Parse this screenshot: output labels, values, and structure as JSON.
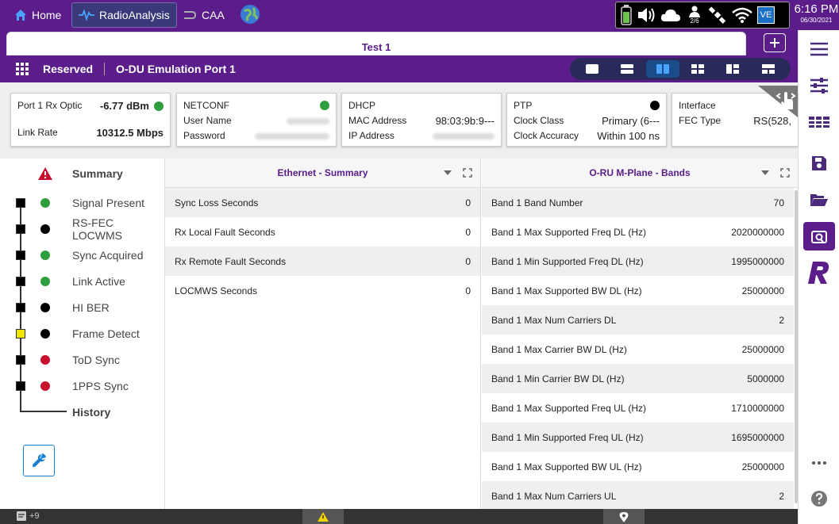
{
  "topbar": {
    "tabs": [
      {
        "label": "Home",
        "icon": "home-icon"
      },
      {
        "label": "RadioAnalysis",
        "icon": "waveform-icon"
      },
      {
        "label": "CAA",
        "icon": "caa-icon"
      }
    ],
    "globe_icon": "globe-icon",
    "status": {
      "user_count": "2/6",
      "badge": "VE"
    },
    "time": "6:16 PM",
    "date": "06/30/2021"
  },
  "header": {
    "test_tab": "Test 1",
    "reserved": "Reserved",
    "port": "O-DU Emulation Port 1"
  },
  "cards": {
    "optic": {
      "label": "Port 1 Rx Optic",
      "value": "-6.77 dBm",
      "link_label": "Link Rate",
      "link_value": "10312.5 Mbps"
    },
    "netconf": {
      "label": "NETCONF",
      "user_label": "User Name",
      "password_label": "Password"
    },
    "dhcp": {
      "label": "DHCP",
      "mac_label": "MAC Address",
      "mac_value": "98:03:9b:9---",
      "ip_label": "IP Address"
    },
    "ptp": {
      "label": "PTP",
      "clock_class_label": "Clock Class",
      "clock_class_value": "Primary (6---",
      "accuracy_label": "Clock Accuracy",
      "accuracy_value": "Within 100 ns"
    },
    "interface": {
      "label": "Interface",
      "fec_label": "FEC Type",
      "fec_value": "RS(528,"
    }
  },
  "summary": {
    "title": "Summary",
    "history": "History",
    "items": [
      {
        "label": "Signal Present",
        "led": "#2e9e3f",
        "hist": "#000"
      },
      {
        "label": "RS-FEC LOCWMS",
        "led": "#000",
        "hist": "#000"
      },
      {
        "label": "Sync Acquired",
        "led": "#2e9e3f",
        "hist": "#000"
      },
      {
        "label": "Link Active",
        "led": "#2e9e3f",
        "hist": "#000"
      },
      {
        "label": "HI BER",
        "led": "#000",
        "hist": "#000"
      },
      {
        "label": "Frame Detect",
        "led": "#000",
        "hist": "#f2e600"
      },
      {
        "label": "ToD Sync",
        "led": "#c8102e",
        "hist": "#000"
      },
      {
        "label": "1PPS Sync",
        "led": "#c8102e",
        "hist": "#000"
      }
    ]
  },
  "ethernet": {
    "title": "Ethernet - Summary",
    "rows": [
      {
        "label": "Sync Loss Seconds",
        "value": "0"
      },
      {
        "label": "Rx Local Fault Seconds",
        "value": "0"
      },
      {
        "label": "Rx Remote Fault Seconds",
        "value": "0"
      },
      {
        "label": "LOCMWS Seconds",
        "value": "0"
      }
    ]
  },
  "bands": {
    "title": "O-RU M-Plane - Bands",
    "rows": [
      {
        "label": "Band 1 Band Number",
        "value": "70"
      },
      {
        "label": "Band 1 Max Supported Freq DL (Hz)",
        "value": "2020000000"
      },
      {
        "label": "Band 1 Min Supported Freq DL (Hz)",
        "value": "1995000000"
      },
      {
        "label": "Band 1 Max Supported BW DL (Hz)",
        "value": "25000000"
      },
      {
        "label": "Band 1 Max Num Carriers DL",
        "value": "2"
      },
      {
        "label": "Band 1 Max Carrier BW DL (Hz)",
        "value": "25000000"
      },
      {
        "label": "Band 1  Min Carrier BW DL (Hz)",
        "value": "5000000"
      },
      {
        "label": "Band 1 Max Supported Freq UL (Hz)",
        "value": "1710000000"
      },
      {
        "label": "Band 1 Min Supported Freq UL (Hz)",
        "value": "1695000000"
      },
      {
        "label": "Band 1 Max Supported BW UL (Hz)",
        "value": "25000000"
      },
      {
        "label": "Band 1 Max Num Carriers UL",
        "value": "2"
      }
    ]
  },
  "bottombar": {
    "messages": "+9"
  },
  "colors": {
    "brand": "#5a1d8a",
    "accent": "#1a4c8a"
  }
}
